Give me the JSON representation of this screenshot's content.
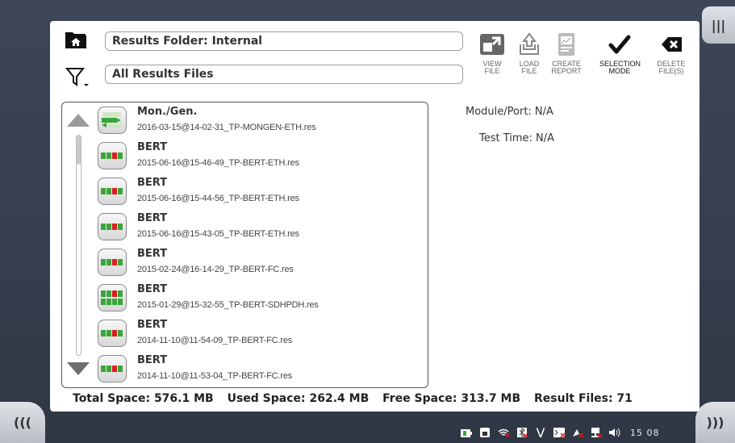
{
  "header": {
    "results_folder": "Results Folder: Internal",
    "filter": "All Results Files"
  },
  "toolbar": [
    {
      "label": "VIEW\nFILE",
      "icon": "view-file-icon"
    },
    {
      "label": "LOAD\nFILE",
      "icon": "load-file-icon"
    },
    {
      "label": "CREATE\nREPORT",
      "icon": "create-report-icon"
    },
    {
      "label": "SELECTION\nMODE",
      "icon": "checkmark-icon"
    },
    {
      "label": "DELETE\nFILE(S)",
      "icon": "delete-icon"
    }
  ],
  "files": [
    {
      "title": "Mon./Gen.",
      "name": "2016-03-15@14-02-31_TP-MONGEN-ETH.res",
      "icon": "mongen-icon"
    },
    {
      "title": "BERT",
      "name": "2015-06-16@15-46-49_TP-BERT-ETH.res",
      "icon": "bert-icon"
    },
    {
      "title": "BERT",
      "name": "2015-06-16@15-44-56_TP-BERT-ETH.res",
      "icon": "bert-icon"
    },
    {
      "title": "BERT",
      "name": "2015-06-16@15-43-05_TP-BERT-ETH.res",
      "icon": "bert-icon"
    },
    {
      "title": "BERT",
      "name": "2015-02-24@16-14-29_TP-BERT-FC.res",
      "icon": "bert-icon"
    },
    {
      "title": "BERT",
      "name": "2015-01-29@15-32-55_TP-BERT-SDHPDH.res",
      "icon": "bert-sdh-icon"
    },
    {
      "title": "BERT",
      "name": "2014-11-10@11-54-09_TP-BERT-FC.res",
      "icon": "bert-icon"
    },
    {
      "title": "BERT",
      "name": "2014-11-10@11-53-04_TP-BERT-FC.res",
      "icon": "bert-icon"
    }
  ],
  "details": {
    "module_port": "Module/Port: N/A",
    "test_time": "Test Time: N/A"
  },
  "summary": {
    "total": "Total Space: 576.1 MB",
    "used": "Used Space: 262.4 MB",
    "free": "Free Space: 313.7 MB",
    "count": "Result Files: 71"
  },
  "status": {
    "clock": "15 08"
  },
  "colors": {
    "background": "#3a4352",
    "panel": "#ffffff",
    "accent_green": "#3aa53a",
    "accent_red": "#d62020"
  }
}
